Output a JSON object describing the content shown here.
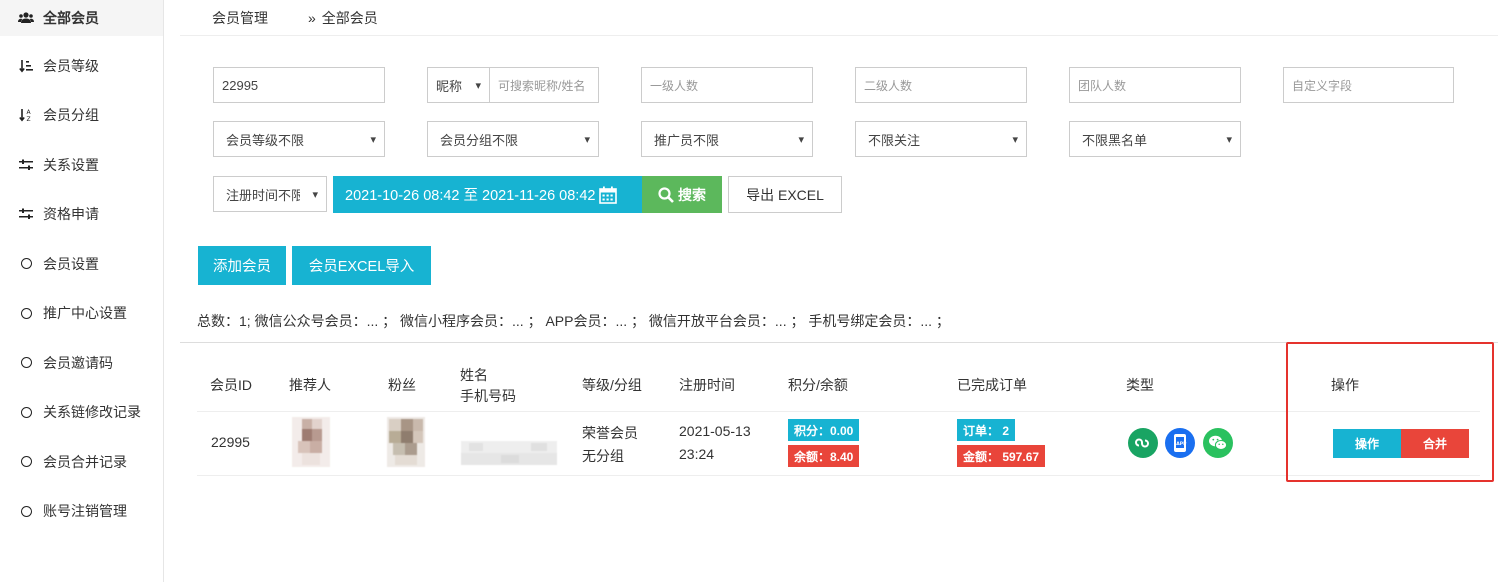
{
  "sidebar": {
    "items": [
      {
        "label": "全部会员",
        "icon": "users-icon",
        "active": true
      },
      {
        "label": "会员等级",
        "icon": "sort-icon"
      },
      {
        "label": "会员分组",
        "icon": "sort-alpha-icon"
      },
      {
        "label": "关系设置",
        "icon": "sliders-icon"
      },
      {
        "label": "资格申请",
        "icon": "sliders-icon"
      },
      {
        "label": "会员设置",
        "icon": "circle-icon"
      },
      {
        "label": "推广中心设置",
        "icon": "circle-icon"
      },
      {
        "label": "会员邀请码",
        "icon": "circle-icon"
      },
      {
        "label": "关系链修改记录",
        "icon": "circle-icon"
      },
      {
        "label": "会员合并记录",
        "icon": "circle-icon"
      },
      {
        "label": "账号注销管理",
        "icon": "circle-icon"
      }
    ]
  },
  "breadcrumb": {
    "parent": "会员管理",
    "separator": "»",
    "current": "全部会员"
  },
  "filters": {
    "member_id_value": "22995",
    "nickname_select": "昵称",
    "nickname_placeholder": "可搜索昵称/姓名",
    "level1_placeholder": "一级人数",
    "level2_placeholder": "二级人数",
    "team_placeholder": "团队人数",
    "custom_placeholder": "自定义字段",
    "level_select": "会员等级不限",
    "group_select": "会员分组不限",
    "promoter_select": "推广员不限",
    "follow_select": "不限关注",
    "blacklist_select": "不限黑名单",
    "regtime_select": "注册时间不限",
    "date_range": "2021-10-26 08:42 至 2021-11-26 08:42",
    "search_label": "搜索",
    "export_label": "导出 EXCEL"
  },
  "actions": {
    "add_member": "添加会员",
    "import_excel": "会员EXCEL导入"
  },
  "stats_text": "总数：1; 微信公众号会员：... ； 微信小程序会员：... ； APP会员：... ； 微信开放平台会员：... ； 手机号绑定会员：... ；",
  "table": {
    "headers": {
      "id": "会员ID",
      "referrer": "推荐人",
      "fans": "粉丝",
      "name": "姓名",
      "phone": "手机号码",
      "level": "等级/分组",
      "regtime": "注册时间",
      "points": "积分/余额",
      "orders": "已完成订单",
      "type": "类型",
      "ops": "操作"
    },
    "rows": [
      {
        "id": "22995",
        "level": "荣誉会员",
        "group": "无分组",
        "reg_date": "2021-05-13",
        "reg_time": "23:24",
        "points": "积分：0.00",
        "balance": "余额：8.40",
        "orders": "订单： 2",
        "amount": "金额： 597.67",
        "op_label": "操作",
        "merge_label": "合并"
      }
    ]
  },
  "colors": {
    "accent": "#17b3d2",
    "danger": "#e9453a",
    "success": "#5cb85c",
    "highlight": "#e5322d"
  }
}
